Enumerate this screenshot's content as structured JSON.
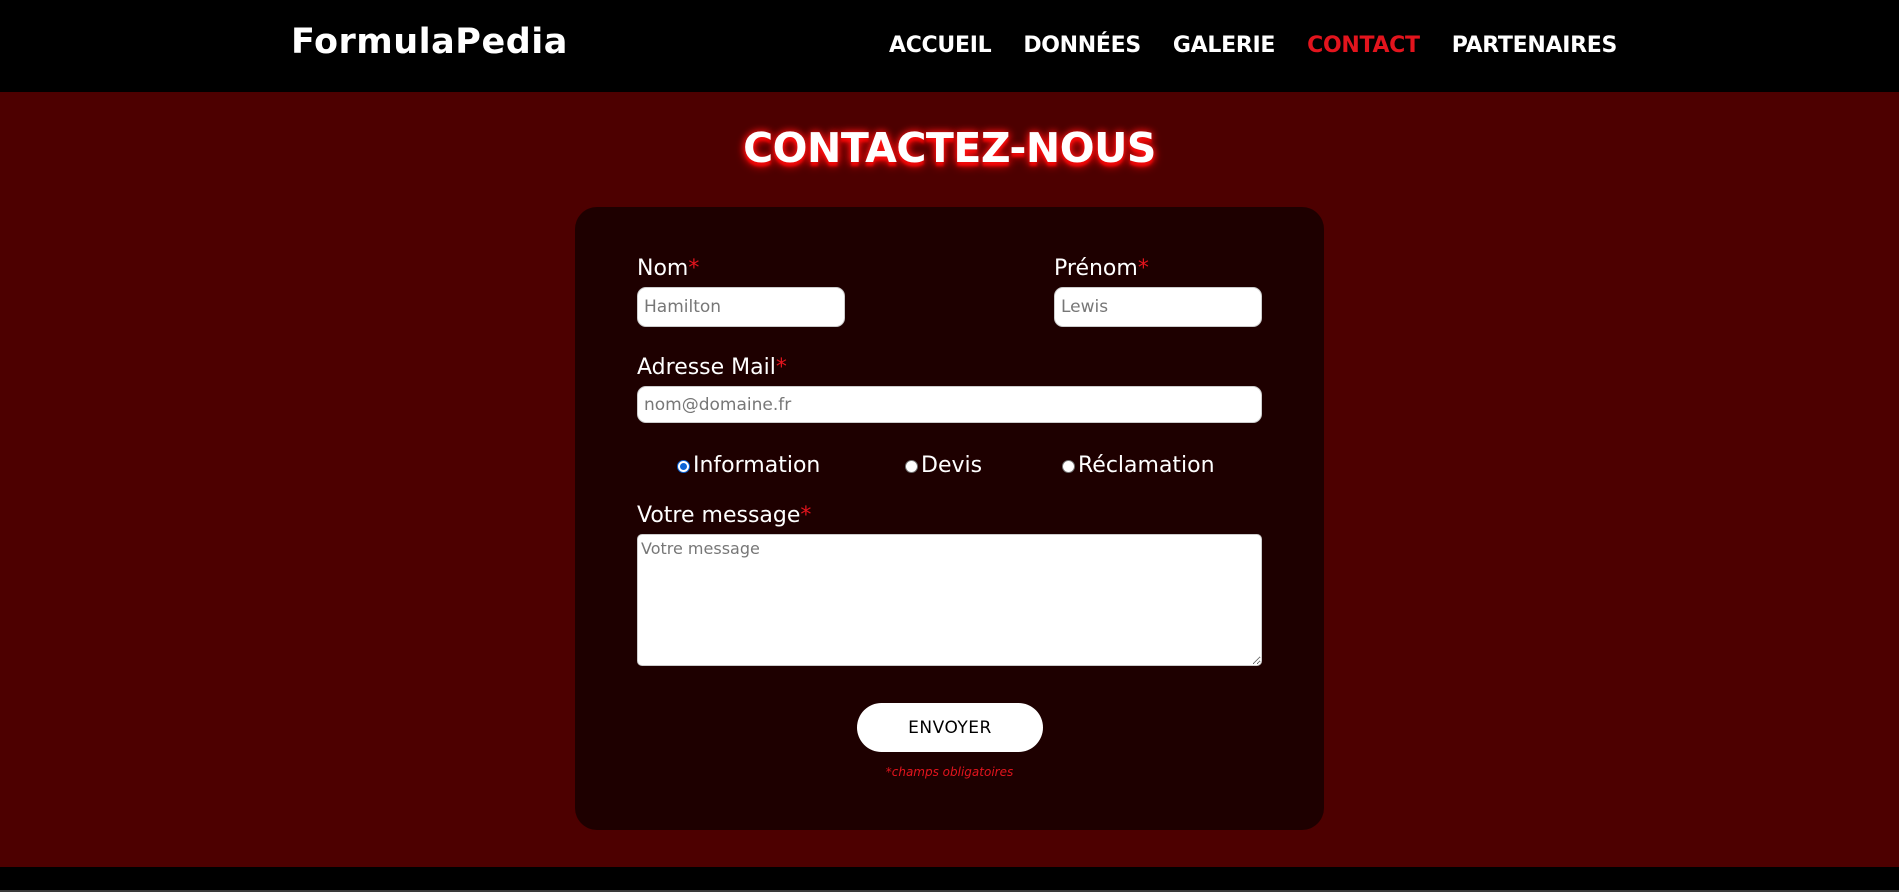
{
  "header": {
    "logo": "FormulaPedia",
    "nav": [
      {
        "label": "ACCUEIL",
        "active": false
      },
      {
        "label": "DONNÉES",
        "active": false
      },
      {
        "label": "GALERIE",
        "active": false
      },
      {
        "label": "CONTACT",
        "active": true
      },
      {
        "label": "PARTENAIRES",
        "active": false
      }
    ]
  },
  "main": {
    "title": "CONTACTEZ-NOUS"
  },
  "form": {
    "required_mark": "*",
    "nom": {
      "label": "Nom",
      "placeholder": "Hamilton",
      "value": ""
    },
    "prenom": {
      "label": "Prénom",
      "placeholder": "Lewis",
      "value": ""
    },
    "email": {
      "label": "Adresse Mail",
      "placeholder": "nom@domaine.fr",
      "value": ""
    },
    "subject_options": [
      {
        "label": "Information",
        "checked": true
      },
      {
        "label": "Devis",
        "checked": false
      },
      {
        "label": "Réclamation",
        "checked": false
      }
    ],
    "message": {
      "label": "Votre message",
      "placeholder": "Votre message",
      "value": ""
    },
    "submit_label": "ENVOYER",
    "required_note": "*champs obligatoires"
  },
  "colors": {
    "page_background": "#4d0000",
    "header_background": "#000000",
    "card_background": "#1e0000",
    "accent": "#e3141d",
    "radio_checked": "#0b63d6"
  }
}
